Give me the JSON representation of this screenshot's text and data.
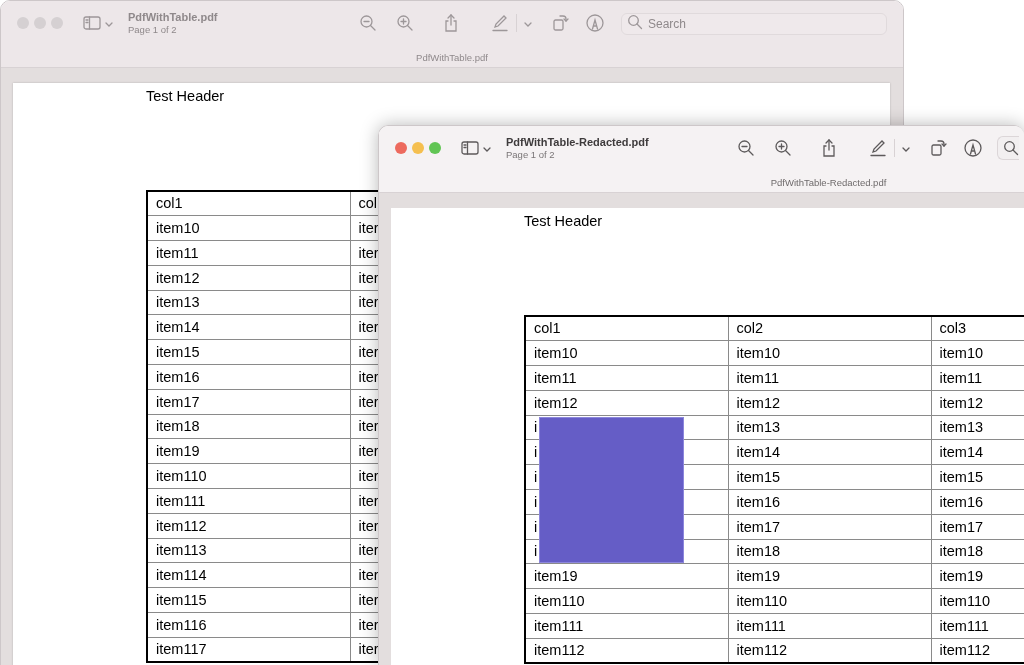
{
  "windows": [
    {
      "active": false,
      "title": "PdfWithTable.pdf",
      "subtitle": "Page 1 of 2",
      "tab_title": "PdfWithTable.pdf",
      "search": {
        "placeholder": "Search"
      },
      "document": {
        "header": "Test Header",
        "columns": [
          "col1",
          "col"
        ],
        "rows": [
          {
            "cells": [
              "item10",
              "iter"
            ],
            "redacted": false
          },
          {
            "cells": [
              "item11",
              "iter"
            ],
            "redacted": false
          },
          {
            "cells": [
              "item12",
              "iter"
            ],
            "redacted": false
          },
          {
            "cells": [
              "item13",
              "iter"
            ],
            "redacted": false
          },
          {
            "cells": [
              "item14",
              "iter"
            ],
            "redacted": false
          },
          {
            "cells": [
              "item15",
              "iter"
            ],
            "redacted": false
          },
          {
            "cells": [
              "item16",
              "iter"
            ],
            "redacted": false
          },
          {
            "cells": [
              "item17",
              "iter"
            ],
            "redacted": false
          },
          {
            "cells": [
              "item18",
              "iter"
            ],
            "redacted": false
          },
          {
            "cells": [
              "item19",
              "iter"
            ],
            "redacted": false
          },
          {
            "cells": [
              "item110",
              "iter"
            ],
            "redacted": false
          },
          {
            "cells": [
              "item111",
              "iter"
            ],
            "redacted": false
          },
          {
            "cells": [
              "item112",
              "iter"
            ],
            "redacted": false
          },
          {
            "cells": [
              "item113",
              "iter"
            ],
            "redacted": false
          },
          {
            "cells": [
              "item114",
              "iter"
            ],
            "redacted": false
          },
          {
            "cells": [
              "item115",
              "iter"
            ],
            "redacted": false
          },
          {
            "cells": [
              "item116",
              "iter"
            ],
            "redacted": false
          },
          {
            "cells": [
              "item117",
              "iter"
            ],
            "redacted": false
          }
        ]
      }
    },
    {
      "active": true,
      "title": "PdfWithTable-Redacted.pdf",
      "subtitle": "Page 1 of 2",
      "tab_title": "PdfWithTable-Redacted.pdf",
      "document": {
        "header": "Test Header",
        "columns": [
          "col1",
          "col2",
          "col3"
        ],
        "rows": [
          {
            "cells": [
              "item10",
              "item10",
              "item10"
            ],
            "redacted": false
          },
          {
            "cells": [
              "item11",
              "item11",
              "item11"
            ],
            "redacted": false
          },
          {
            "cells": [
              "item12",
              "item12",
              "item12"
            ],
            "redacted": false
          },
          {
            "cells": [
              "i",
              "item13",
              "item13"
            ],
            "redacted": true
          },
          {
            "cells": [
              "i",
              "item14",
              "item14"
            ],
            "redacted": true
          },
          {
            "cells": [
              "i",
              "item15",
              "item15"
            ],
            "redacted": true
          },
          {
            "cells": [
              "i",
              "item16",
              "item16"
            ],
            "redacted": true
          },
          {
            "cells": [
              "i",
              "item17",
              "item17"
            ],
            "redacted": true
          },
          {
            "cells": [
              "i",
              "item18",
              "item18"
            ],
            "redacted": true
          },
          {
            "cells": [
              "item19",
              "item19",
              "item19"
            ],
            "redacted": false
          },
          {
            "cells": [
              "item110",
              "item110",
              "item110"
            ],
            "redacted": false
          },
          {
            "cells": [
              "item111",
              "item111",
              "item111"
            ],
            "redacted": false
          },
          {
            "cells": [
              "item112",
              "item112",
              "item112"
            ],
            "redacted": false
          }
        ]
      }
    }
  ]
}
